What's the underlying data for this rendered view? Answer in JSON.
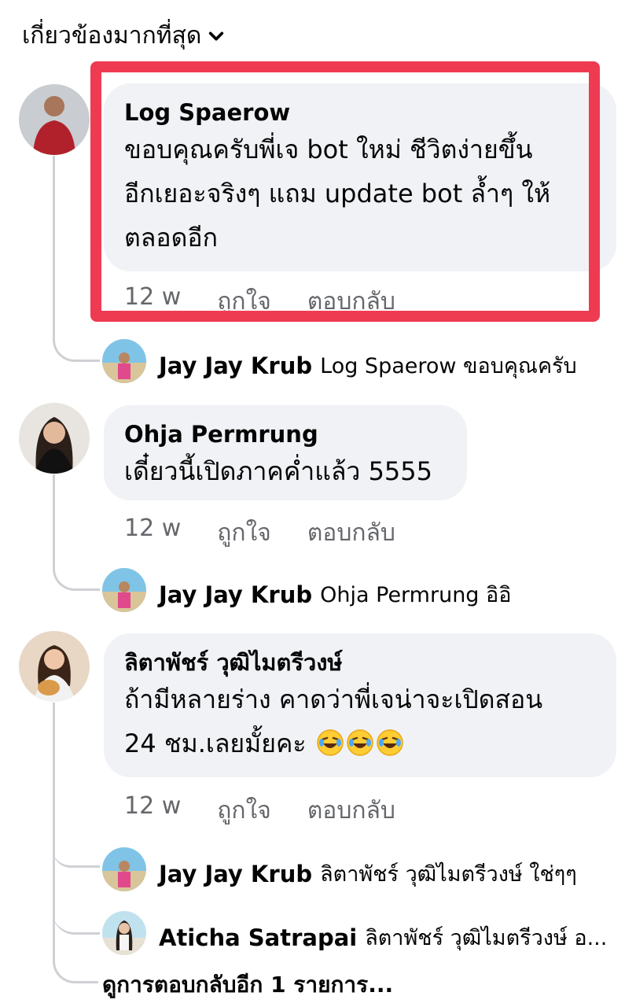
{
  "sort": {
    "label": "เกี่ยวข้องมากที่สุด"
  },
  "comments": [
    {
      "author": "Log Spaerow",
      "lines": [
        "ขอบคุณครับพี่เจ bot ใหม่ ชีวิตง่ายขึ้น",
        "อีกเยอะจริงๆ แถม update bot ล้ำๆ ให้",
        "ตลอดอีก"
      ],
      "time": "12 w",
      "like": "ถูกใจ",
      "reply": "ตอบกลับ",
      "replies": [
        {
          "name": "Jay Jay Krub",
          "text": "Log Spaerow ขอบคุณครับ"
        }
      ]
    },
    {
      "author": "Ohja Permrung",
      "lines": [
        "เดี๋ยวนี้เปิดภาคค่ำแล้ว 5555"
      ],
      "time": "12 w",
      "like": "ถูกใจ",
      "reply": "ตอบกลับ",
      "replies": [
        {
          "name": "Jay Jay Krub",
          "text": "Ohja Permrung อิอิ"
        }
      ]
    },
    {
      "author": "ลิตาพัชร์ วุฒิไมตรีวงษ์",
      "lines": [
        "ถ้ามีหลายร่าง คาดว่าพี่เจน่าจะเปิดสอน",
        "24 ชม.เลยมั้ยคะ"
      ],
      "time": "12 w",
      "like": "ถูกใจ",
      "reply": "ตอบกลับ",
      "replies": [
        {
          "name": "Jay Jay Krub",
          "text": "ลิตาพัชร์ วุฒิไมตรีวงษ์ ใช่ๆๆ"
        },
        {
          "name": "Aticha Satrapai",
          "text": "ลิตาพัชร์ วุฒิไมตรีวงษ์ อ..."
        }
      ],
      "more_replies": "ดูการตอบกลับอีก 1 รายการ..."
    }
  ],
  "colors": {
    "highlight": "#ef3b52",
    "bubble": "#f0f2f5",
    "muted": "#65676b"
  },
  "icons": {
    "sort": "chevron-down-icon",
    "emoji": "rolling-on-floor-laughing-emoji"
  }
}
